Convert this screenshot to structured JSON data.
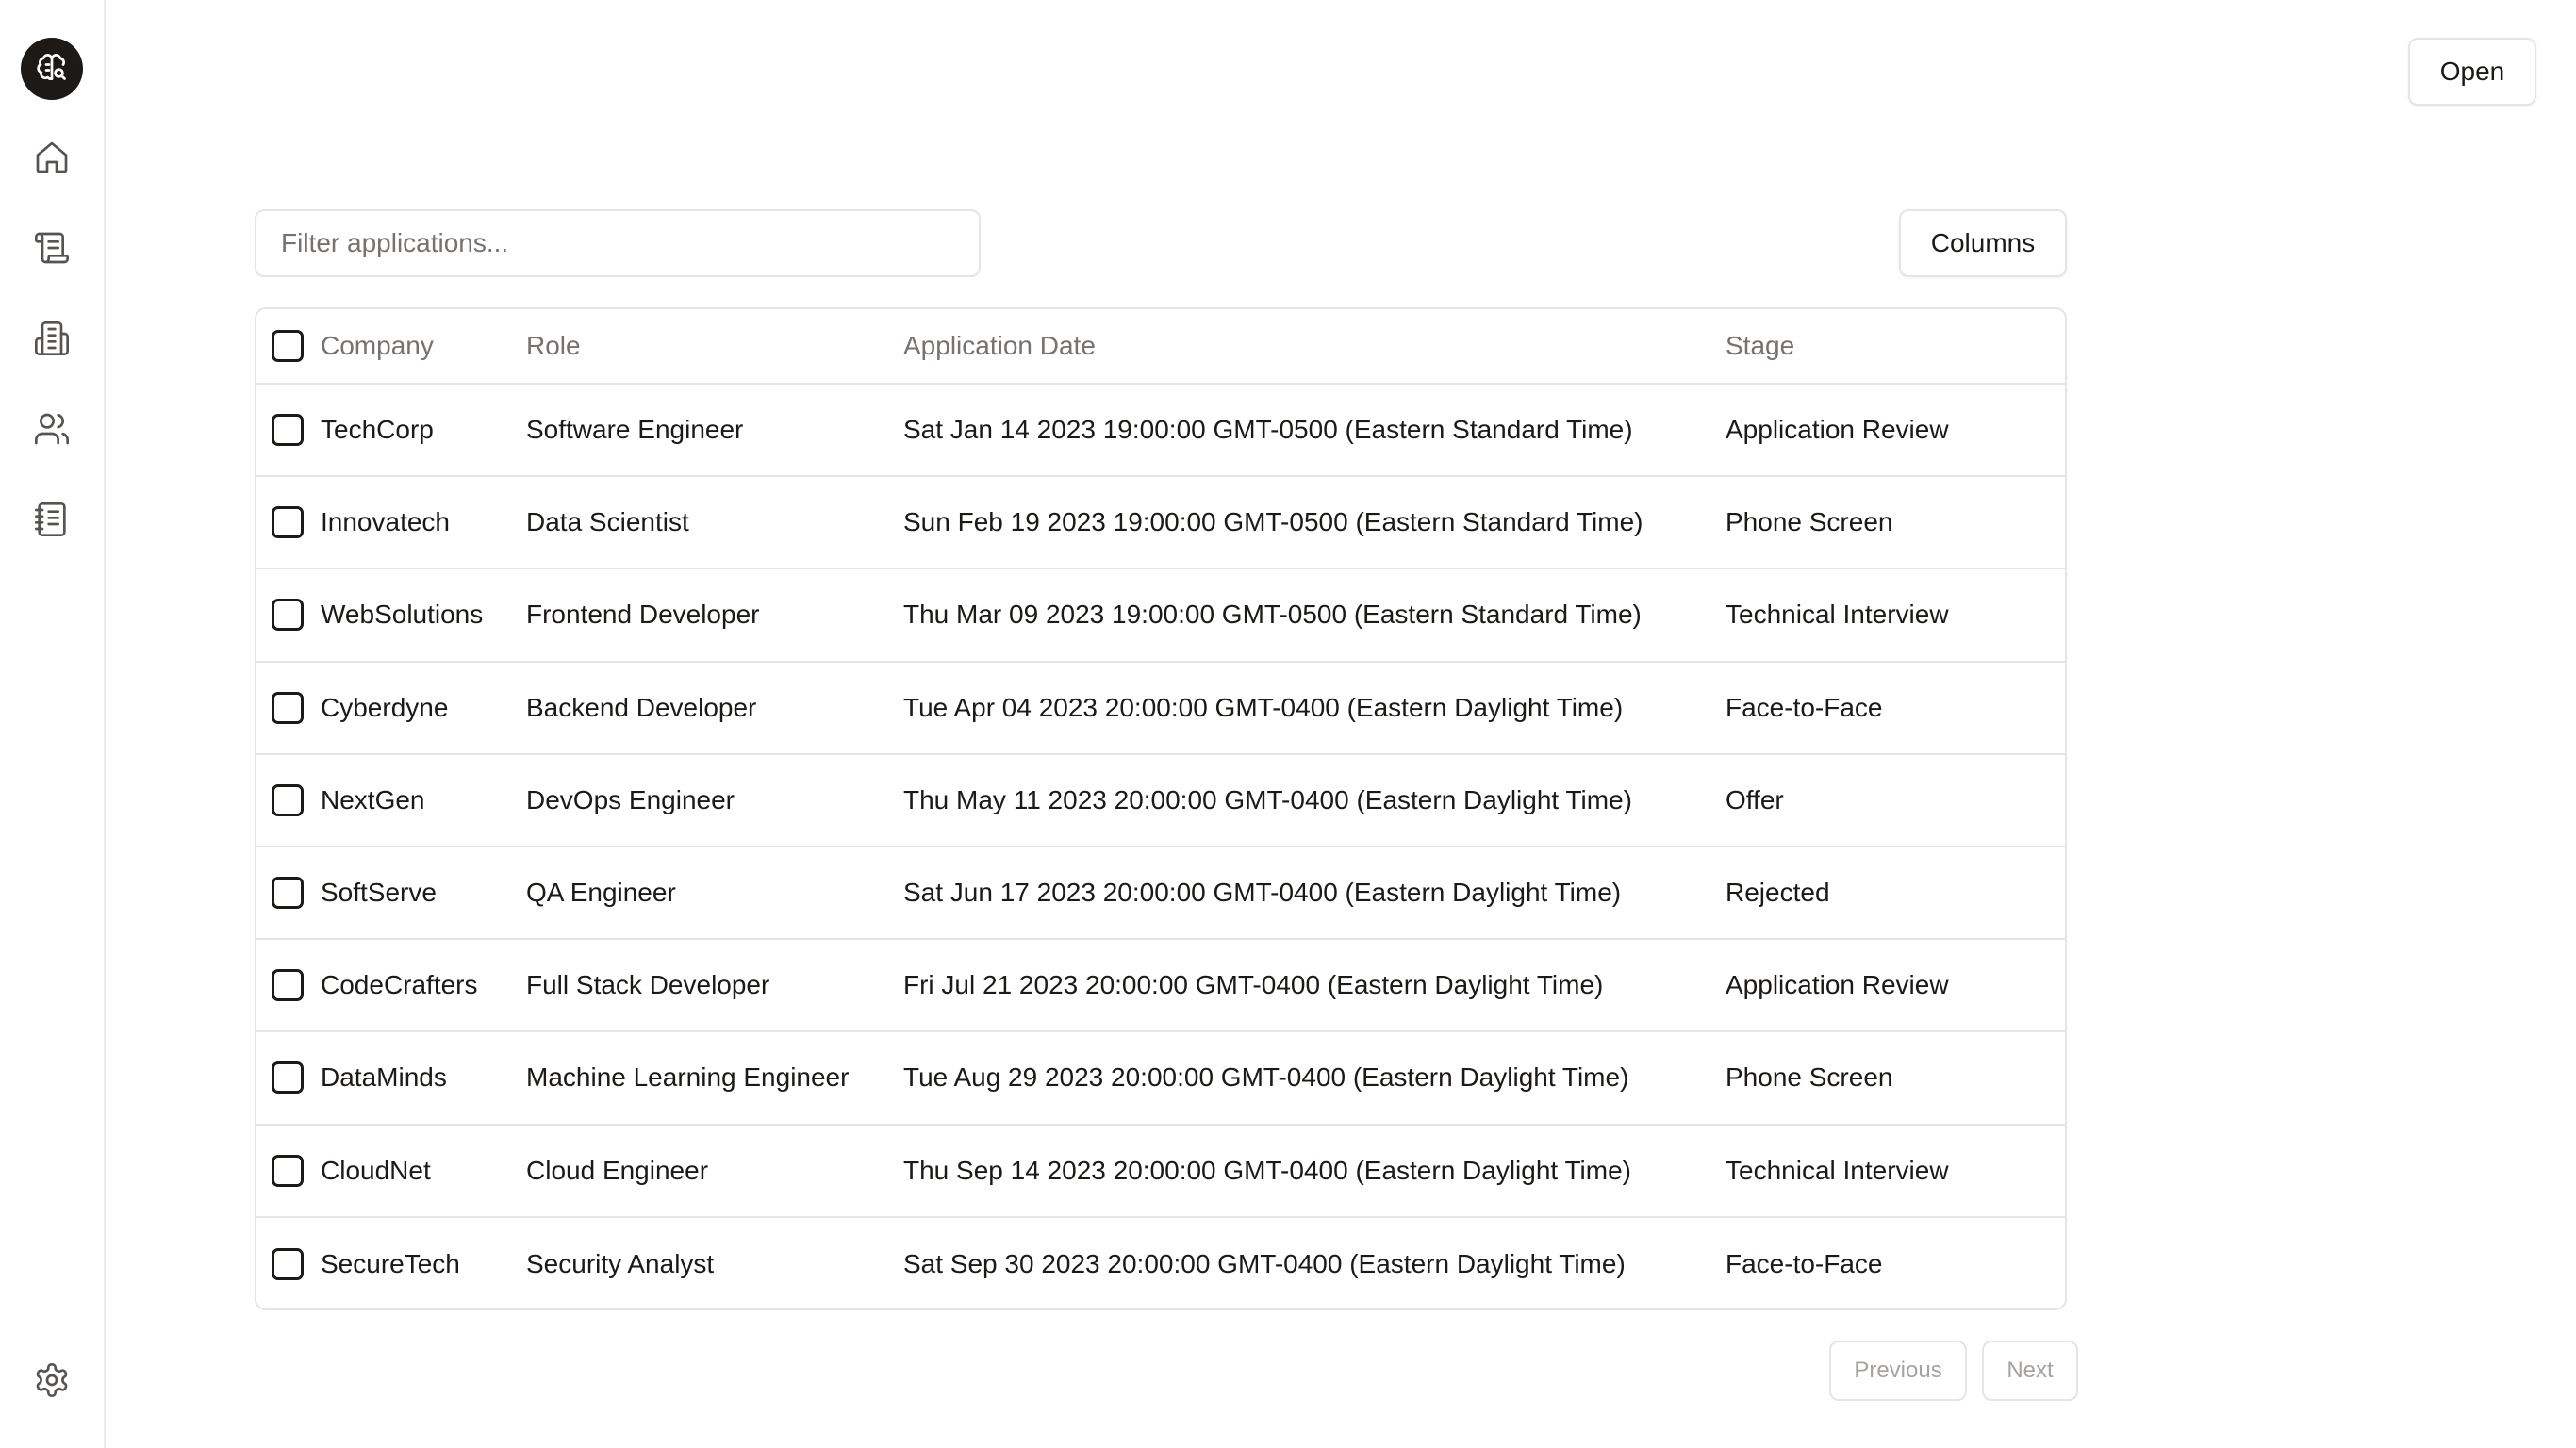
{
  "topbar": {
    "open_label": "Open"
  },
  "sidebar": {
    "logo_icon": "brain-icon",
    "items": [
      {
        "icon": "home-icon"
      },
      {
        "icon": "scroll-icon"
      },
      {
        "icon": "building-icon"
      },
      {
        "icon": "users-icon"
      },
      {
        "icon": "notebook-icon"
      }
    ],
    "footer_icon": "settings-icon"
  },
  "toolbar": {
    "filter_placeholder": "Filter applications...",
    "filter_value": "",
    "columns_label": "Columns"
  },
  "table": {
    "columns": [
      "Company",
      "Role",
      "Application Date",
      "Stage"
    ],
    "rows": [
      {
        "company": "TechCorp",
        "role": "Software Engineer",
        "date": "Sat Jan 14 2023 19:00:00 GMT-0500 (Eastern Standard Time)",
        "stage": "Application Review"
      },
      {
        "company": "Innovatech",
        "role": "Data Scientist",
        "date": "Sun Feb 19 2023 19:00:00 GMT-0500 (Eastern Standard Time)",
        "stage": "Phone Screen"
      },
      {
        "company": "WebSolutions",
        "role": "Frontend Developer",
        "date": "Thu Mar 09 2023 19:00:00 GMT-0500 (Eastern Standard Time)",
        "stage": "Technical Interview"
      },
      {
        "company": "Cyberdyne",
        "role": "Backend Developer",
        "date": "Tue Apr 04 2023 20:00:00 GMT-0400 (Eastern Daylight Time)",
        "stage": "Face-to-Face"
      },
      {
        "company": "NextGen",
        "role": "DevOps Engineer",
        "date": "Thu May 11 2023 20:00:00 GMT-0400 (Eastern Daylight Time)",
        "stage": "Offer"
      },
      {
        "company": "SoftServe",
        "role": "QA Engineer",
        "date": "Sat Jun 17 2023 20:00:00 GMT-0400 (Eastern Daylight Time)",
        "stage": "Rejected"
      },
      {
        "company": "CodeCrafters",
        "role": "Full Stack Developer",
        "date": "Fri Jul 21 2023 20:00:00 GMT-0400 (Eastern Daylight Time)",
        "stage": "Application Review"
      },
      {
        "company": "DataMinds",
        "role": "Machine Learning Engineer",
        "date": "Tue Aug 29 2023 20:00:00 GMT-0400 (Eastern Daylight Time)",
        "stage": "Phone Screen"
      },
      {
        "company": "CloudNet",
        "role": "Cloud Engineer",
        "date": "Thu Sep 14 2023 20:00:00 GMT-0400 (Eastern Daylight Time)",
        "stage": "Technical Interview"
      },
      {
        "company": "SecureTech",
        "role": "Security Analyst",
        "date": "Sat Sep 30 2023 20:00:00 GMT-0400 (Eastern Daylight Time)",
        "stage": "Face-to-Face"
      }
    ]
  },
  "pagination": {
    "previous_label": "Previous",
    "next_label": "Next"
  },
  "colors": {
    "text": "#1c1917",
    "muted": "#78716c",
    "border": "#e7e5e4",
    "logo_bg": "#1c1917"
  }
}
